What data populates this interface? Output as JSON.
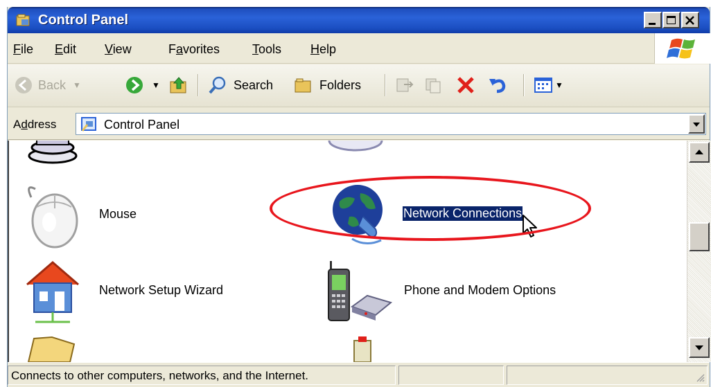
{
  "window": {
    "title": "Control Panel"
  },
  "menu": {
    "items": [
      {
        "accel": "F",
        "rest": "ile"
      },
      {
        "accel": "E",
        "rest": "dit"
      },
      {
        "accel": "V",
        "rest": "iew"
      },
      {
        "pre": "F",
        "accel": "a",
        "rest": "vorites"
      },
      {
        "accel": "T",
        "rest": "ools"
      },
      {
        "accel": "H",
        "rest": "elp"
      }
    ]
  },
  "toolbar": {
    "back": "Back",
    "search": "Search",
    "folders": "Folders"
  },
  "address": {
    "label_pre": "A",
    "label_accel": "d",
    "label_rest": "dress",
    "value": "Control Panel"
  },
  "items": {
    "mouse": "Mouse",
    "network_connections": "Network Connections",
    "network_setup_wizard": "Network Setup Wizard",
    "phone_modem": "Phone and Modem Options"
  },
  "status": {
    "text": "Connects to other computers, networks, and the Internet."
  },
  "colors": {
    "selection": "#0a246a",
    "annotation": "#e8161d",
    "titlebar": "#2a62d8"
  },
  "icons": [
    "folder-icon",
    "minimize-icon",
    "maximize-icon",
    "close-icon",
    "windows-flag-icon",
    "back-arrow-icon",
    "forward-arrow-icon",
    "up-folder-icon",
    "search-icon",
    "folders-icon",
    "move-to-icon",
    "copy-to-icon",
    "delete-icon",
    "undo-icon",
    "views-icon",
    "control-panel-icon",
    "mouse-icon",
    "network-connections-icon",
    "network-setup-icon",
    "phone-modem-icon",
    "cursor-icon"
  ]
}
